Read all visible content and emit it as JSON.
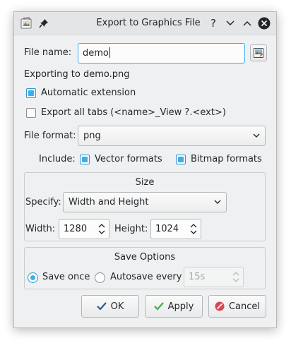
{
  "window": {
    "title": "Export to Graphics File",
    "help_glyph": "?"
  },
  "file_name": {
    "label": "File name:",
    "value": "demo"
  },
  "exporting_text": "Exporting to demo.png",
  "automatic_extension": {
    "label": "Automatic extension",
    "checked": true
  },
  "export_all_tabs": {
    "label": "Export all tabs (<name>_View ?.<ext>)",
    "checked": false
  },
  "file_format": {
    "label": "File format:",
    "value": "png"
  },
  "include": {
    "label": "Include:",
    "vector_label": "Vector formats",
    "vector_checked": true,
    "bitmap_label": "Bitmap formats",
    "bitmap_checked": true
  },
  "size_group": {
    "title": "Size",
    "specify_label": "Specify:",
    "specify_value": "Width and Height",
    "width_label": "Width:",
    "width_value": "1280",
    "height_label": "Height:",
    "height_value": "1024"
  },
  "save_options": {
    "title": "Save Options",
    "save_once_label": "Save once",
    "save_once_selected": true,
    "autosave_label": "Autosave every",
    "autosave_value": "15s"
  },
  "buttons": {
    "ok": "OK",
    "apply": "Apply",
    "cancel": "Cancel"
  },
  "colors": {
    "accent": "#3daee9",
    "window_bg": "#eff0f1",
    "close_button": "#232629"
  },
  "icons": {
    "app": "export-image-icon",
    "pin": "pin-icon",
    "help": "help-icon",
    "minimize": "chevron-down-icon",
    "maximize": "chevron-up-icon",
    "close": "close-icon",
    "browse": "browse-file-icon",
    "ok": "check-icon",
    "apply": "check-green-icon",
    "cancel": "cancel-icon"
  }
}
